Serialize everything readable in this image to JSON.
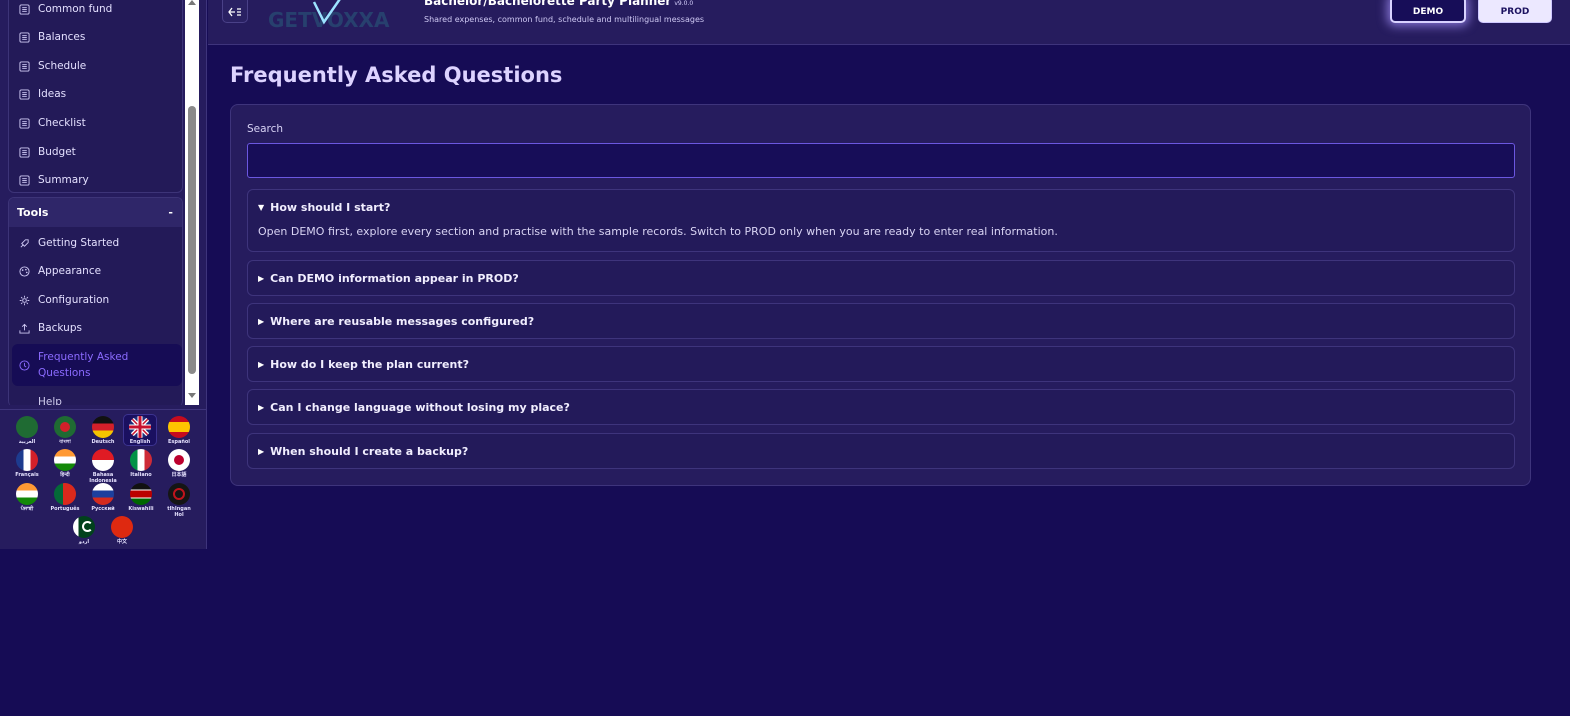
{
  "sidebar": {
    "main_items": [
      {
        "label": "Common fund",
        "icon": "list-icon"
      },
      {
        "label": "Balances",
        "icon": "list-icon"
      },
      {
        "label": "Schedule",
        "icon": "list-icon"
      },
      {
        "label": "Ideas",
        "icon": "list-icon"
      },
      {
        "label": "Checklist",
        "icon": "list-icon"
      },
      {
        "label": "Budget",
        "icon": "list-icon"
      },
      {
        "label": "Summary",
        "icon": "list-icon"
      }
    ],
    "tools_header": "Tools",
    "tools_toggle": "-",
    "tools_items": [
      {
        "label": "Getting Started",
        "icon": "rocket-icon"
      },
      {
        "label": "Appearance",
        "icon": "palette-icon"
      },
      {
        "label": "Configuration",
        "icon": "gear-icon"
      },
      {
        "label": "Backups",
        "icon": "upload-icon"
      },
      {
        "label": "Frequently Asked Questions",
        "icon": "help-circle-icon"
      },
      {
        "label": "Help",
        "icon": "help-icon"
      }
    ]
  },
  "languages": [
    {
      "label": "العربية"
    },
    {
      "label": "বাংলা"
    },
    {
      "label": "Deutsch"
    },
    {
      "label": "English"
    },
    {
      "label": "Español"
    },
    {
      "label": "Français"
    },
    {
      "label": "हिन्दी"
    },
    {
      "label": "Bahasa Indonesia"
    },
    {
      "label": "Italiano"
    },
    {
      "label": "日本語"
    },
    {
      "label": "ਪੰਜਾਬੀ"
    },
    {
      "label": "Português"
    },
    {
      "label": "Русский"
    },
    {
      "label": "Kiswahili"
    },
    {
      "label": "tlhIngan Hol"
    },
    {
      "label": "اردو"
    },
    {
      "label": "中文"
    }
  ],
  "header": {
    "logo_text": "GETVOXXA",
    "app_title": "Bachelor/Bachelorette Party Planner",
    "version": "v9.0.0",
    "subtitle": "Shared expenses, common fund, schedule and multilingual messages",
    "demo_label": "DEMO",
    "prod_label": "PROD"
  },
  "main": {
    "page_title": "Frequently Asked Questions",
    "search_label": "Search",
    "search_value": "",
    "faqs": [
      {
        "question": "How should I start?",
        "answer": "Open DEMO first, explore every section and practise with the sample records. Switch to PROD only when you are ready to enter real information.",
        "expanded": true
      },
      {
        "question": "Can DEMO information appear in PROD?",
        "expanded": false
      },
      {
        "question": "Where are reusable messages configured?",
        "expanded": false
      },
      {
        "question": "How do I keep the plan current?",
        "expanded": false
      },
      {
        "question": "Can I change language without losing my place?",
        "expanded": false
      },
      {
        "question": "When should I create a backup?",
        "expanded": false
      }
    ],
    "expanded_marker": "▼",
    "collapsed_marker": "▶"
  },
  "colors": {
    "background": "#160c55",
    "panel": "#261c5e",
    "accent": "#8b6bff",
    "input_border": "#6b57e0"
  }
}
